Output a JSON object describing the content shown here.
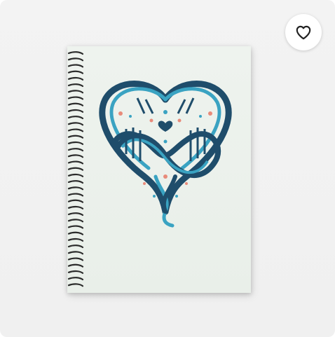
{
  "product": {
    "kind": "spiral-notebook",
    "artwork_icon": "dna-heart-icon",
    "colors": {
      "card_background": "#f0f0f0",
      "cover": "#eaf0ea",
      "strand_dark": "#1f4d6b",
      "strand_light": "#3aa3c2",
      "accent_dot": "#e88b7a"
    }
  },
  "favorite": {
    "icon": "heart-outline-icon",
    "state": "not-favorited"
  }
}
